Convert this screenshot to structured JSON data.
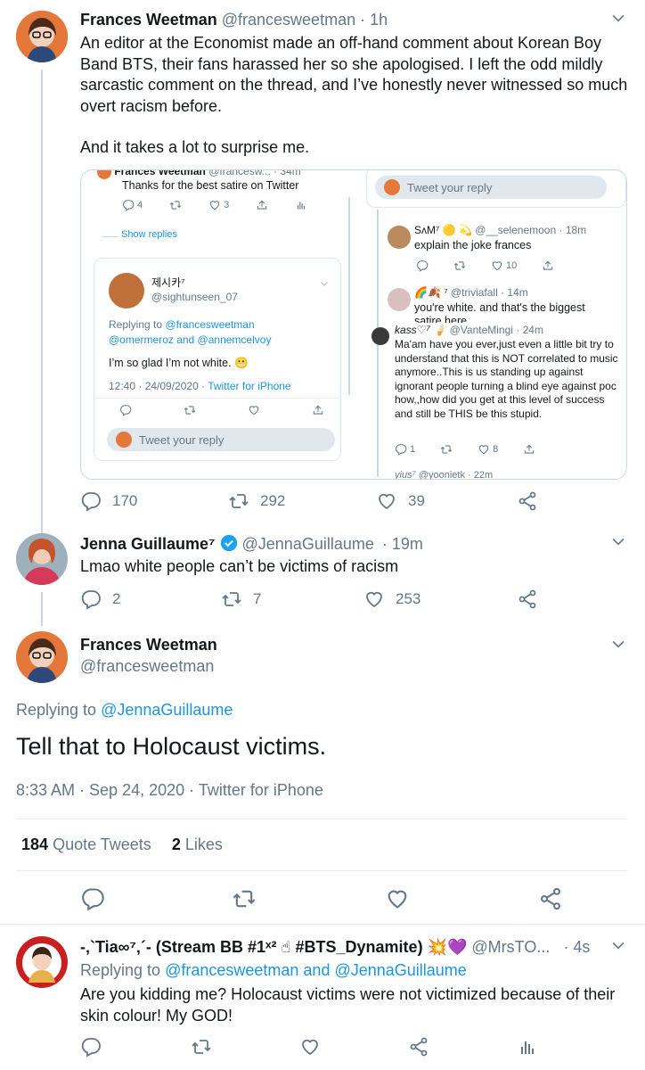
{
  "tweet1": {
    "name": "Frances Weetman",
    "handle": "@francesweetman",
    "time": "· 1h",
    "text_p1": "An editor at the Economist made an off-hand comment about Korean Boy Band BTS, their fans harassed her so she apologised. I left the odd mildly sarcastic comment on the thread, and I’ve honestly never witnessed so much overt racism before.",
    "text_p2": "And it takes a lot to surprise me.",
    "replies": "170",
    "retweets": "292",
    "likes": "39"
  },
  "embed": {
    "top_reply_text": "Thanks for the best satire on Twitter",
    "top_counts": {
      "replies": "4",
      "likes": "3"
    },
    "show_replies": "Show replies",
    "card": {
      "name": "제시카⁷",
      "handle": "@sightunseen_07",
      "replying_prefix": "Replying to",
      "replying_1": "@francesweetman",
      "replying_2": "@omermeroz and @annemcelvoy",
      "text": "I’m so glad I’m not white. 😬",
      "meta_time": "12:40 · 24/09/2020 ·",
      "meta_source": "Twitter for iPhone",
      "reply_placeholder": "Tweet your reply"
    },
    "right_reply_placeholder": "Tweet your reply",
    "r1": {
      "name": "SᴧM⁷ 🟡 💫",
      "handle": "@__selenemoon · 18m",
      "text": "explain the joke frances",
      "likes": "10"
    },
    "r2": {
      "name": "🌈🍂 ⁷",
      "handle": "@triviafall · 14m",
      "text": "you're white. and that's the biggest satire here"
    },
    "r3": {
      "name": "kass♡⁷ 🍦",
      "handle": "@VanteMingi · 24m",
      "text": "Ma'am have you ever,just even a little bit try to understand that this is NOT correlated to music anymore..This is us standing up against ignorant people turning a blind eye against poc how,,how did you get at this level of success and still be THIS be this stupid.",
      "replies": "1",
      "likes": "8"
    },
    "r4": {
      "handle": "@yoonietk · 22m"
    }
  },
  "tweet2": {
    "name": "Jenna Guillaume⁷",
    "handle": "@JennaGuillaume",
    "time": "· 19m",
    "text": "Lmao white people can’t be victims of racism",
    "replies": "2",
    "retweets": "7",
    "likes": "253"
  },
  "main": {
    "name": "Frances Weetman",
    "handle": "@francesweetman",
    "replying_prefix": "Replying to",
    "replying_to": "@JennaGuillaume",
    "text": "Tell that to Holocaust victims.",
    "time": "8:33 AM · Sep 24, 2020 ·",
    "source": "Twitter for iPhone",
    "quote_count": "184",
    "quote_label": "Quote Tweets",
    "likes_count": "2",
    "likes_label": "Likes"
  },
  "reply": {
    "name": "-‚`Tia∞⁷‚´- (Stream BB #1ˣ² ☝ #BTS_Dynamite) 💥💜",
    "handle": "@MrsTO...",
    "time": "· 4s",
    "replying_prefix": "Replying to",
    "replying_to": "@francesweetman and @JennaGuillaume",
    "text": "Are you kidding me? Holocaust victims were not victimized because of their skin colour! My GOD!"
  },
  "colors": {
    "accent": "#1b95e0",
    "muted": "#657786",
    "verified": "#1da1f2"
  },
  "icons": [
    "reply-icon",
    "retweet-icon",
    "like-icon",
    "share-icon",
    "chevron-down-icon",
    "verified-icon",
    "analytics-icon"
  ]
}
